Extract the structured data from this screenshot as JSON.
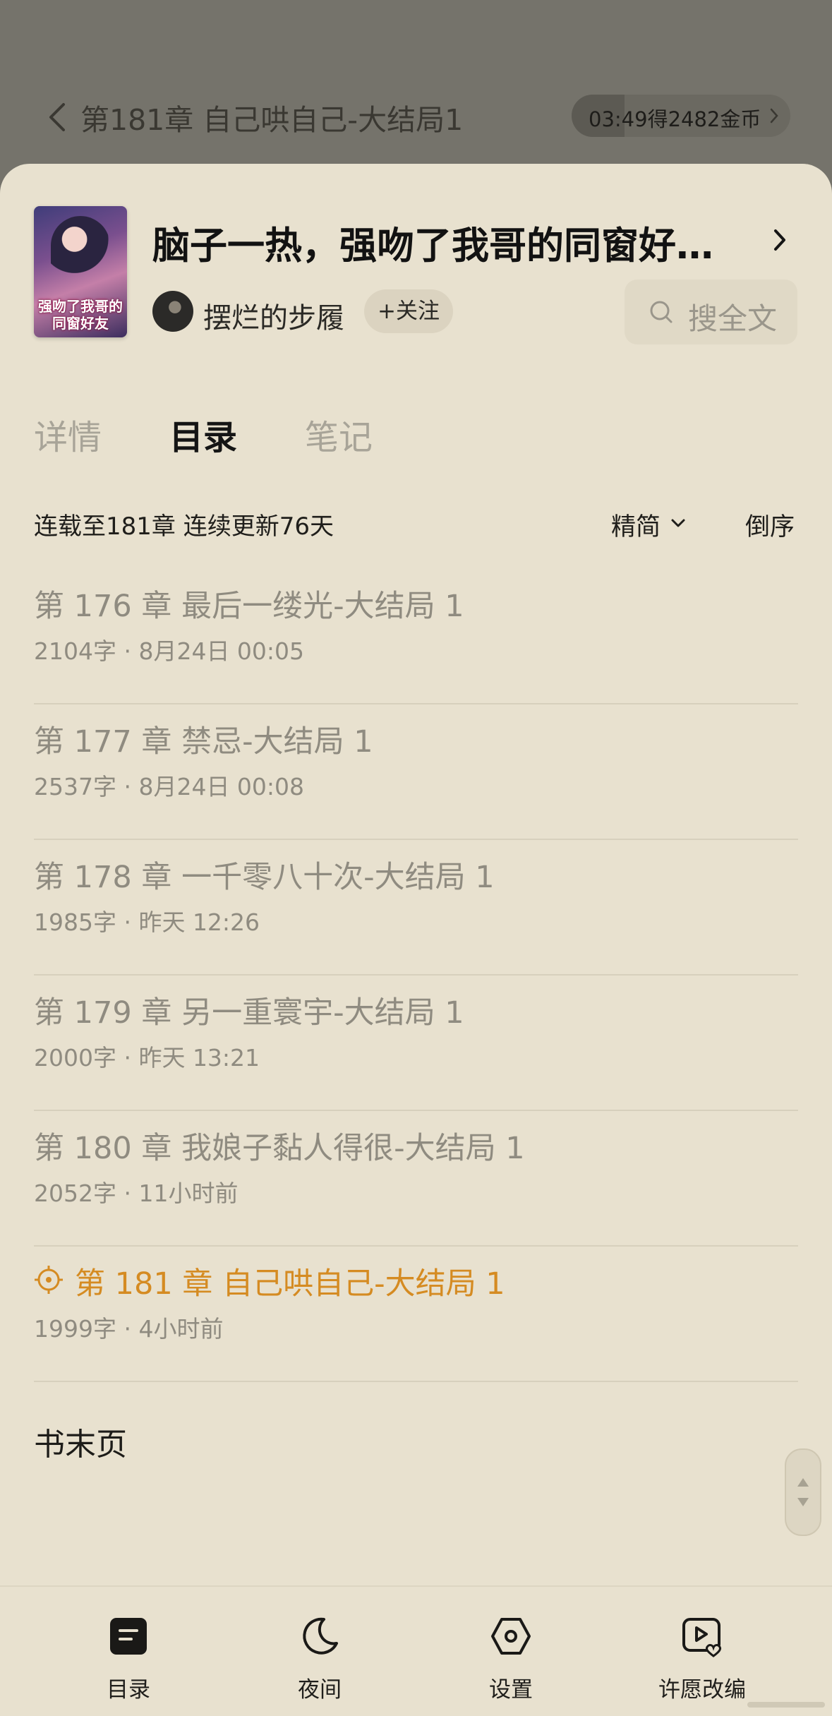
{
  "reader_bar": {
    "chapter_title": "第181章 自己哄自己-大结局1",
    "coin_timer": "03:49得2482金币"
  },
  "book": {
    "title": "脑子一热，强吻了我哥的同窗好…",
    "cover_text": "强吻了我哥的同窗好友",
    "author": "摆烂的步履",
    "follow_label": "+关注",
    "search_label": "搜全文"
  },
  "tabs": [
    {
      "label": "详情",
      "active": false
    },
    {
      "label": "目录",
      "active": true
    },
    {
      "label": "笔记",
      "active": false
    }
  ],
  "toc": {
    "status": "连载至181章 连续更新76天",
    "filter_label": "精简",
    "order_label": "倒序",
    "chapters": [
      {
        "title": "第 176 章 最后一缕光-大结局 1",
        "meta": "2104字 · 8月24日 00:05",
        "current": false
      },
      {
        "title": "第 177 章 禁忌-大结局 1",
        "meta": "2537字 · 8月24日 00:08",
        "current": false
      },
      {
        "title": "第 178 章 一千零八十次-大结局 1",
        "meta": "1985字 · 昨天 12:26",
        "current": false
      },
      {
        "title": "第 179 章 另一重寰宇-大结局 1",
        "meta": "2000字 · 昨天 13:21",
        "current": false
      },
      {
        "title": "第 180 章 我娘子黏人得很-大结局 1",
        "meta": "2052字 · 11小时前",
        "current": false
      },
      {
        "title": "第 181 章 自己哄自己-大结局 1",
        "meta": "1999字 · 4小时前",
        "current": true
      }
    ],
    "book_end_label": "书末页"
  },
  "bottom_nav": [
    {
      "label": "目录",
      "icon": "toc-icon"
    },
    {
      "label": "夜间",
      "icon": "moon-icon"
    },
    {
      "label": "设置",
      "icon": "settings-icon"
    },
    {
      "label": "许愿改编",
      "icon": "wish-adapt-icon"
    }
  ],
  "colors": {
    "sheet_bg": "#e8e1cf",
    "accent_current": "#d58b22",
    "muted_text": "#8f8b80"
  }
}
